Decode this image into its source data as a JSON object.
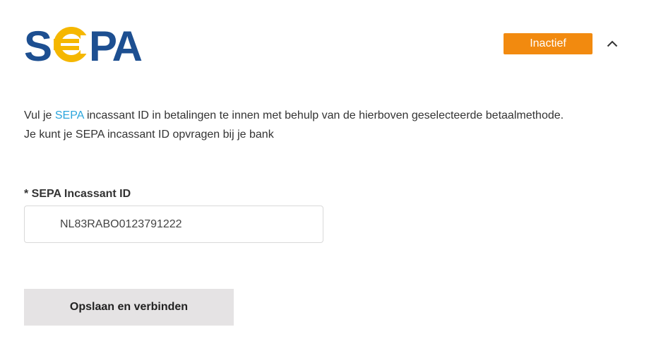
{
  "logo": {
    "text": "SEPA"
  },
  "status": {
    "label": "Inactief",
    "color": "#f28a0f"
  },
  "toggle": {
    "icon": "chevron-up-icon"
  },
  "description": {
    "line1_before": "Vul je ",
    "line1_link": "SEPA",
    "line1_after": " incassant ID in betalingen te innen met behulp van de hierboven geselecteerde betaalmethode.",
    "line2": "Je kunt je SEPA incassant ID opvragen bij je bank"
  },
  "form": {
    "label": "* SEPA Incassant ID",
    "value": "NL83RABO0123791222"
  },
  "actions": {
    "submit_label": "Opslaan en verbinden"
  },
  "colors": {
    "accent": "#f28a0f",
    "link": "#2ba5dc",
    "brand_blue": "#1d4f91",
    "brand_yellow": "#f5b700"
  }
}
